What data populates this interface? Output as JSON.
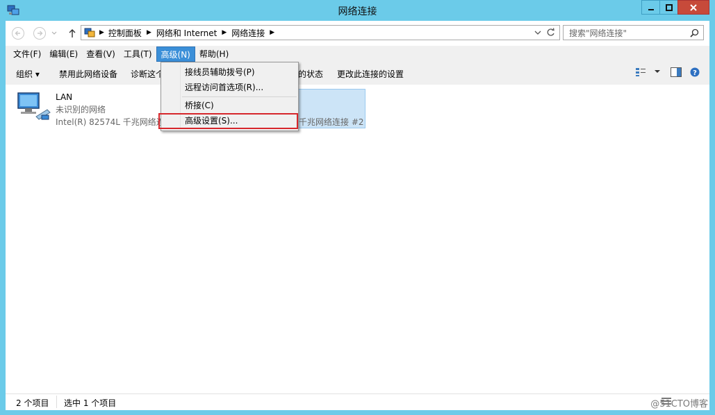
{
  "window": {
    "title": "网络连接"
  },
  "caption": {
    "minimize": "minimize",
    "maximize": "maximize",
    "close": "close"
  },
  "address": {
    "breadcrumbs": [
      "控制面板",
      "网络和 Internet",
      "网络连接"
    ],
    "search_placeholder": "搜索\"网络连接\""
  },
  "menubar": {
    "items": [
      "文件(F)",
      "编辑(E)",
      "查看(V)",
      "工具(T)",
      "高级(N)",
      "帮助(H)"
    ],
    "active": "高级(N)"
  },
  "toolbar": {
    "organize": "组织 ▾",
    "disable": "禁用此网络设备",
    "diagnose": "诊断这个",
    "status": "的状态",
    "change_settings": "更改此连接的设置"
  },
  "connections": [
    {
      "name": "LAN",
      "status": "未识别的网络",
      "adapter": "Intel(R) 82574L 千兆网络连"
    },
    {
      "name": "",
      "status": "",
      "adapter": "千兆网络连接 #2"
    }
  ],
  "dropdown": {
    "items": [
      "接线员辅助拨号(P)",
      "远程访问首选项(R)...",
      "桥接(C)",
      "高级设置(S)..."
    ]
  },
  "statusbar": {
    "count": "2 个项目",
    "selected": "选中 1 个项目"
  },
  "watermark": "@51CTO博客",
  "colors": {
    "frame": "#6bcbe9",
    "menu_active": "#3b8fd8",
    "highlight": "#d6262b",
    "selection": "#cce4f7"
  }
}
